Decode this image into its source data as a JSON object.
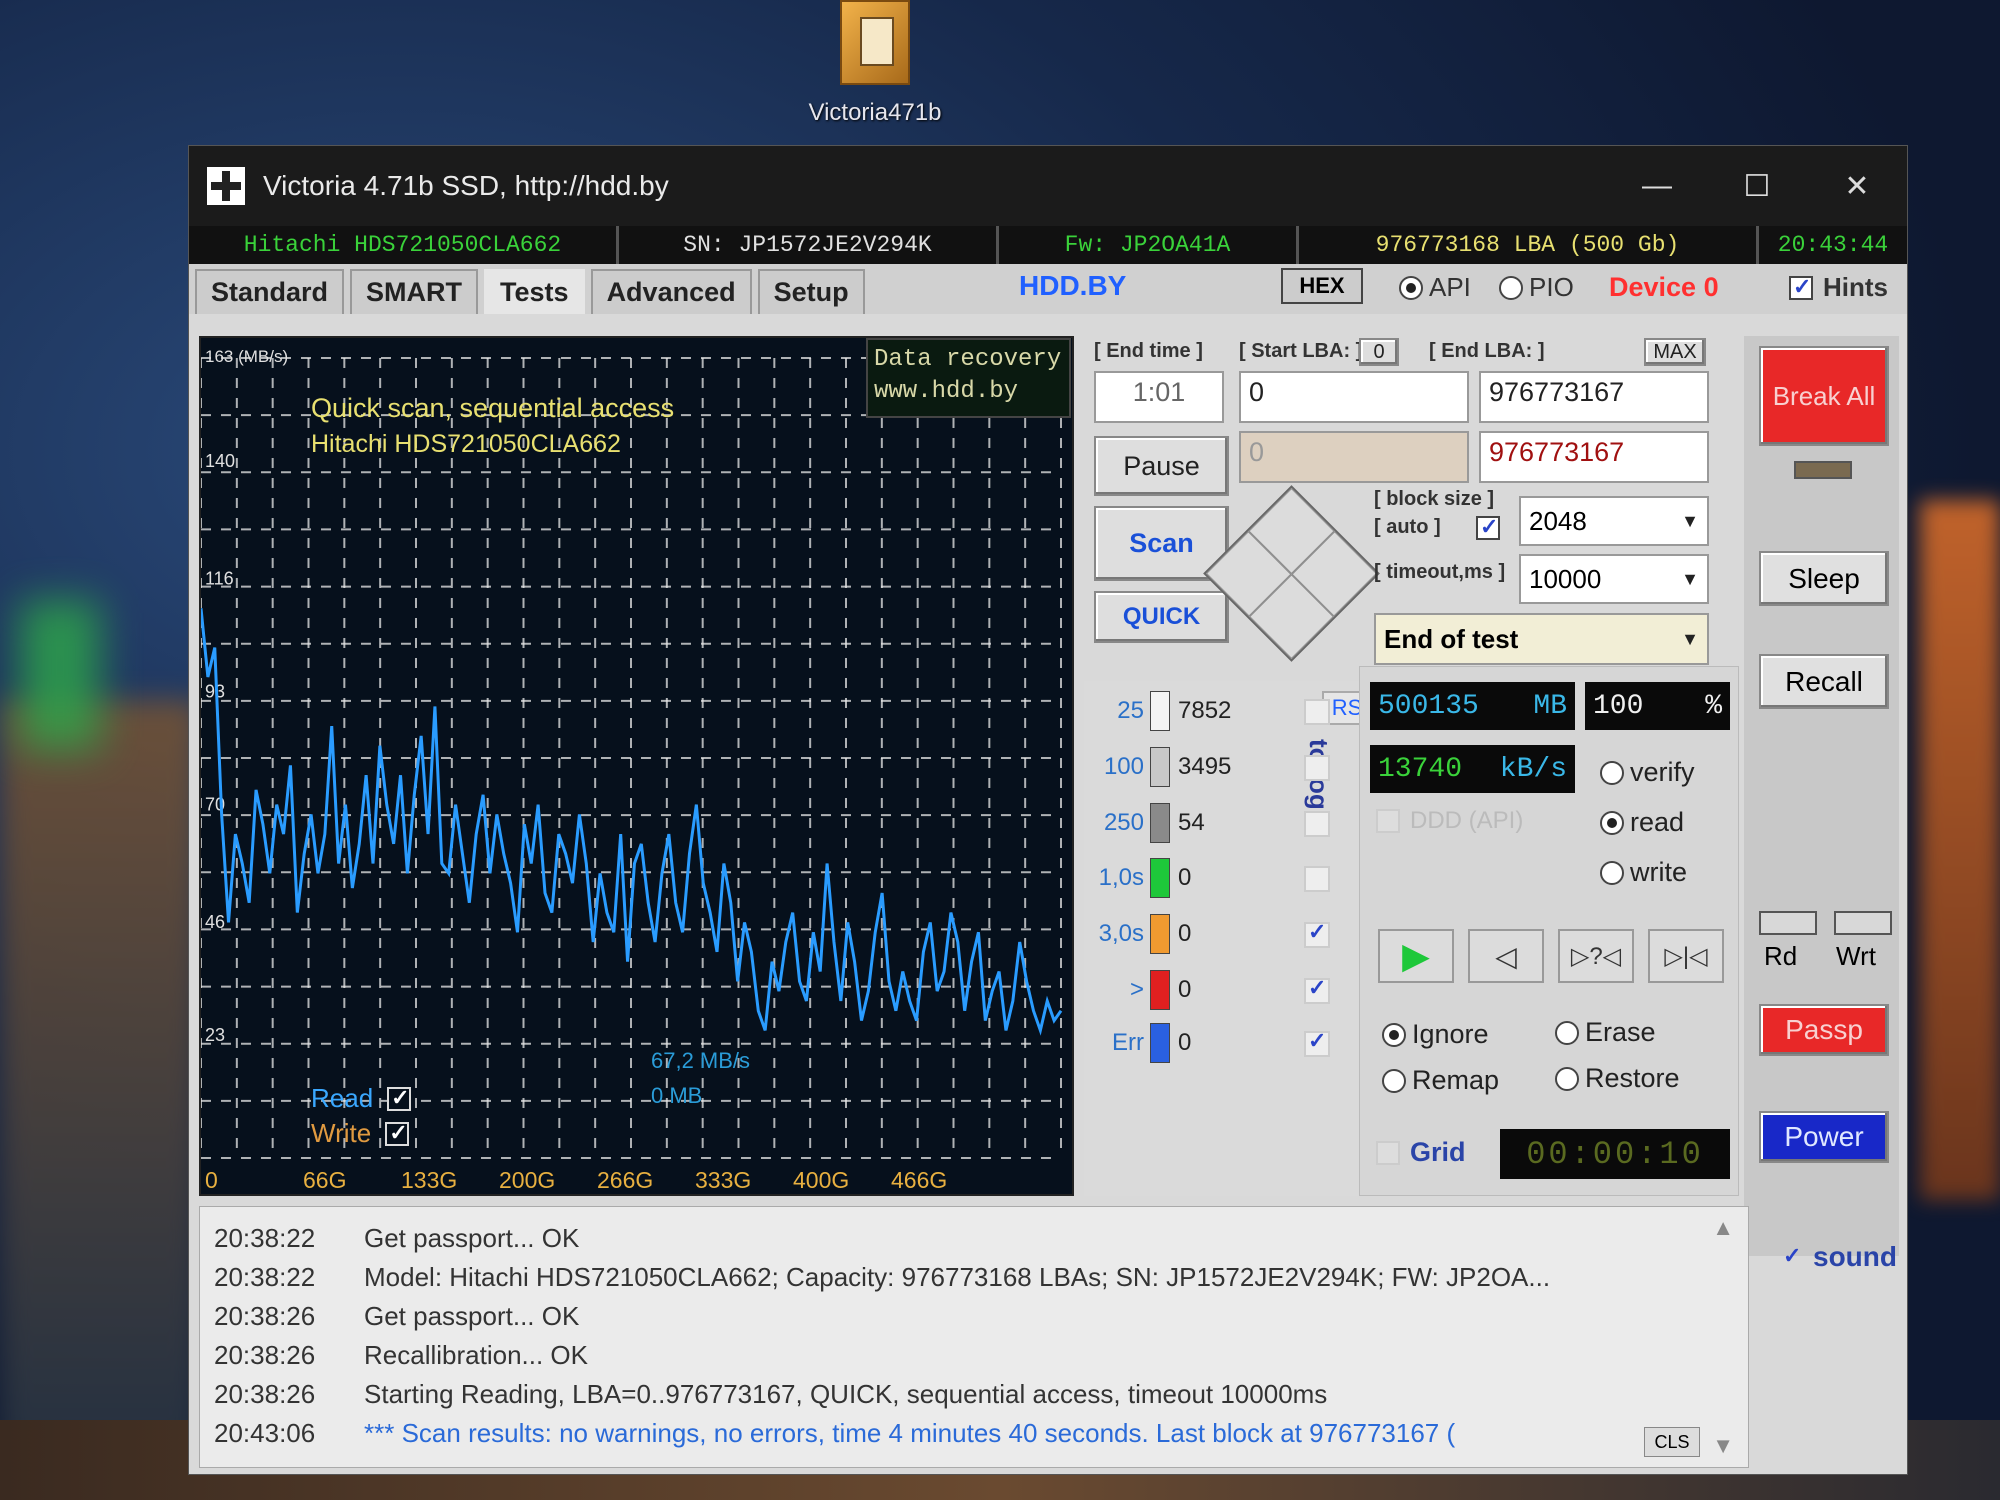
{
  "desktop": {
    "icon_label": "Victoria471b"
  },
  "window": {
    "title": "Victoria 4.71b SSD, http://hdd.by",
    "btn_min": "—",
    "btn_max": "☐",
    "btn_close": "✕"
  },
  "infobar": {
    "model": "Hitachi HDS721050CLA662",
    "serial": "SN: JP1572JE2V294K",
    "firmware": "Fw: JP2OA41A",
    "lba": "976773168 LBA (500 Gb)",
    "clock": "20:43:44"
  },
  "tabs": [
    "Standard",
    "SMART",
    "Tests",
    "Advanced",
    "Setup"
  ],
  "active_tab": "Tests",
  "top": {
    "hddby": "HDD.BY",
    "hex": "HEX",
    "api": "API",
    "pio": "PIO",
    "device": "Device 0",
    "hints": "Hints"
  },
  "graph": {
    "ymax_label": "163 (MB/s)",
    "title": "Quick scan, sequential access",
    "subtitle": "Hitachi HDS721050CLA662",
    "data_recovery_1": "Data recovery",
    "data_recovery_2": "www.hdd.by",
    "legend_read": "Read",
    "legend_write": "Write",
    "speed": "67,2 MB/s",
    "mb": "0 MB"
  },
  "chart_data": {
    "type": "line",
    "title": "Quick scan, sequential access",
    "subtitle": "Hitachi HDS721050CLA662",
    "ylabel": "163 (MB/s)",
    "ylim": [
      0,
      163
    ],
    "yticks": [
      "23",
      "46",
      "70",
      "93",
      "116",
      "140"
    ],
    "ytick_values": [
      23,
      46,
      70,
      93,
      116,
      140
    ],
    "xticks": [
      "0",
      "66G",
      "133G",
      "200G",
      "266G",
      "333G",
      "400G",
      "466G"
    ],
    "xlim": [
      0,
      500
    ],
    "grid": true,
    "series": [
      {
        "name": "Read",
        "color": "#2a9cff",
        "x": [
          0,
          4,
          8,
          12,
          16,
          20,
          24,
          28,
          32,
          36,
          40,
          44,
          48,
          52,
          56,
          60,
          64,
          68,
          72,
          76,
          80,
          84,
          88,
          92,
          96,
          100,
          104,
          108,
          112,
          116,
          120,
          124,
          128,
          132,
          136,
          140,
          144,
          148,
          152,
          156,
          160,
          164,
          168,
          172,
          176,
          180,
          184,
          188,
          192,
          196,
          200,
          204,
          208,
          212,
          216,
          220,
          224,
          228,
          232,
          236,
          240,
          244,
          248,
          252,
          256,
          260,
          264,
          268,
          272,
          276,
          280,
          284,
          288,
          292,
          296,
          300,
          304,
          308,
          312,
          316,
          320,
          324,
          328,
          332,
          336,
          340,
          344,
          348,
          352,
          356,
          360,
          364,
          368,
          372,
          376,
          380,
          384,
          388,
          392,
          396,
          400,
          404,
          408,
          412,
          416,
          420,
          424,
          428,
          432,
          436,
          440,
          444,
          448,
          452,
          456,
          460,
          464,
          468,
          472,
          476,
          480,
          484,
          488,
          492,
          496,
          500
        ],
        "y": [
          112,
          98,
          104,
          70,
          48,
          66,
          60,
          52,
          75,
          68,
          58,
          72,
          66,
          80,
          50,
          62,
          70,
          58,
          66,
          88,
          60,
          72,
          55,
          64,
          78,
          60,
          84,
          72,
          64,
          78,
          58,
          74,
          86,
          66,
          92,
          60,
          58,
          72,
          62,
          52,
          66,
          74,
          58,
          70,
          62,
          56,
          46,
          68,
          60,
          72,
          54,
          50,
          66,
          62,
          56,
          70,
          60,
          44,
          58,
          50,
          46,
          66,
          40,
          60,
          64,
          52,
          44,
          58,
          66,
          52,
          46,
          62,
          72,
          56,
          50,
          42,
          60,
          52,
          36,
          48,
          42,
          30,
          26,
          40,
          34,
          44,
          50,
          36,
          32,
          46,
          38,
          60,
          44,
          32,
          48,
          40,
          28,
          34,
          46,
          54,
          36,
          30,
          38,
          32,
          28,
          42,
          48,
          34,
          38,
          50,
          44,
          30,
          40,
          46,
          28,
          34,
          38,
          26,
          32,
          44,
          36,
          30,
          26,
          32,
          28,
          30
        ]
      }
    ]
  },
  "controls": {
    "end_time_lbl": "[ End time ]",
    "end_time": "1:01",
    "start_lba_lbl": "[ Start LBA: ]",
    "start_lba_zero": "0",
    "end_lba_lbl": "[ End LBA: ]",
    "max": "MAX",
    "start_lba": "0",
    "end_lba": "976773167",
    "start_lba_cur": "0",
    "end_lba_cur": "976773167",
    "pause": "Pause",
    "scan": "Scan",
    "quick": "QUICK",
    "block_size_lbl": "[ block size ]",
    "auto_lbl": "[ auto ]",
    "block_size": "2048",
    "timeout_lbl": "[ timeout,ms ]",
    "timeout": "10000",
    "end_action": "End of test"
  },
  "stats": {
    "rs": "RS",
    "to_log": "to log:",
    "rows": [
      {
        "label": "25",
        "value": "7852",
        "color": "#f4f4f4"
      },
      {
        "label": "100",
        "value": "3495",
        "color": "#c8c8c8"
      },
      {
        "label": "250",
        "value": "54",
        "color": "#8a8a8a"
      },
      {
        "label": "1,0s",
        "value": "0",
        "color": "#1ec83a"
      },
      {
        "label": "3,0s",
        "value": "0",
        "color": "#f09a30"
      },
      {
        "label": ">",
        "value": "0",
        "color": "#e02020"
      },
      {
        "label": "Err",
        "value": "0",
        "color": "#2a60e0"
      }
    ]
  },
  "progress": {
    "mb": "500135",
    "mb_unit": "MB",
    "pct": "100",
    "pct_unit": "%",
    "speed": "13740",
    "speed_unit": "kB/s",
    "ddd": "DDD (API)",
    "mode_verify": "verify",
    "mode_read": "read",
    "mode_write": "write",
    "opt_ignore": "Ignore",
    "opt_erase": "Erase",
    "opt_remap": "Remap",
    "opt_restore": "Restore",
    "grid": "Grid",
    "timer": "00:00:10"
  },
  "right": {
    "break_all": "Break All",
    "sleep": "Sleep",
    "recall": "Recall",
    "rd": "Rd",
    "wrt": "Wrt",
    "passp": "Passp",
    "power": "Power",
    "sound": "sound"
  },
  "log": {
    "lines": [
      {
        "time": "20:38:22",
        "msg": "Get passport... OK"
      },
      {
        "time": "20:38:22",
        "msg": "Model: Hitachi HDS721050CLA662; Capacity: 976773168 LBAs; SN: JP1572JE2V294K; FW: JP2OA..."
      },
      {
        "time": "20:38:26",
        "msg": "Get passport... OK"
      },
      {
        "time": "20:38:26",
        "msg": "Recallibration... OK"
      },
      {
        "time": "20:38:26",
        "msg": "Starting Reading, LBA=0..976773167, QUICK, sequential access, timeout 10000ms"
      },
      {
        "time": "20:43:06",
        "msg": "*** Scan results: no warnings, no errors, time 4 minutes 40 seconds. Last block at 976773167 ("
      }
    ],
    "cls": "CLS"
  }
}
